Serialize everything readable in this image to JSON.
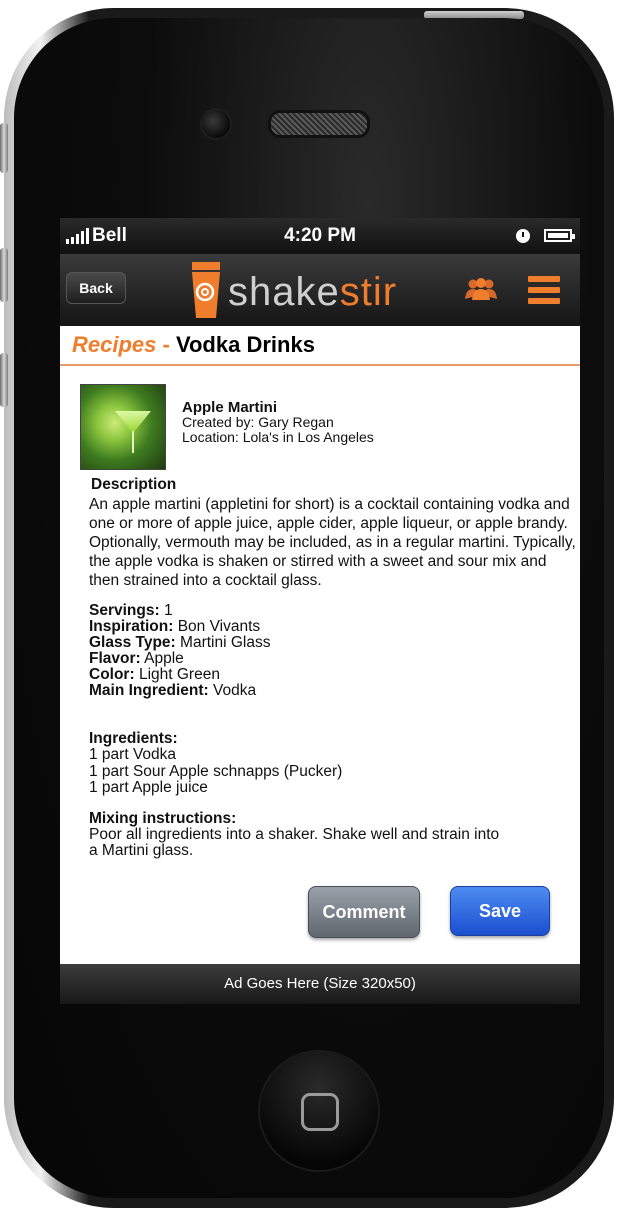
{
  "status_bar": {
    "carrier": "Bell",
    "time": "4:20 PM"
  },
  "nav": {
    "back_label": "Back",
    "logo_part1": "shake",
    "logo_part2": "stir",
    "icons": [
      "people-icon",
      "menu-icon"
    ]
  },
  "page_title": {
    "section": "Recipes",
    "separator": " - ",
    "category": "Vodka Drinks"
  },
  "recipe": {
    "name": "Apple Martini",
    "created_by": "Created by: Gary Regan",
    "location": "Location: Lola's in Los Angeles"
  },
  "description": {
    "heading": "Description",
    "text": "An apple martini (appletini for short) is a cocktail containing vodka and one or more of apple juice, apple cider, apple liqueur, or apple brandy. Optionally, vermouth may be included, as in a regular martini. Typically, the apple vodka is shaken or stirred with a sweet and sour mix and then strained into a cocktail glass."
  },
  "properties": [
    {
      "label": "Servings:",
      "value": "1"
    },
    {
      "label": "Inspiration:",
      "value": "Bon Vivants"
    },
    {
      "label": "Glass Type:",
      "value": "Martini Glass"
    },
    {
      "label": "Flavor:",
      "value": "Apple"
    },
    {
      "label": "Color:",
      "value": "Light Green"
    },
    {
      "label": "Main Ingredient:",
      "value": "Vodka"
    }
  ],
  "ingredients": {
    "heading": "Ingredients:",
    "items": [
      "1 part Vodka",
      "1 part Sour Apple schnapps (Pucker)",
      "1 part Apple juice"
    ]
  },
  "mixing": {
    "heading": "Mixing instructions:",
    "lines": [
      "Poor all ingredients into a shaker. Shake well and strain into",
      "a Martini glass."
    ]
  },
  "actions": {
    "comment_label": "Comment",
    "save_label": "Save"
  },
  "ad_text": "Ad Goes Here (Size 320x50)",
  "colors": {
    "accent": "#ef7d2b",
    "save_blue": "#2f6ee0",
    "comment_gray": "#7a8189"
  }
}
